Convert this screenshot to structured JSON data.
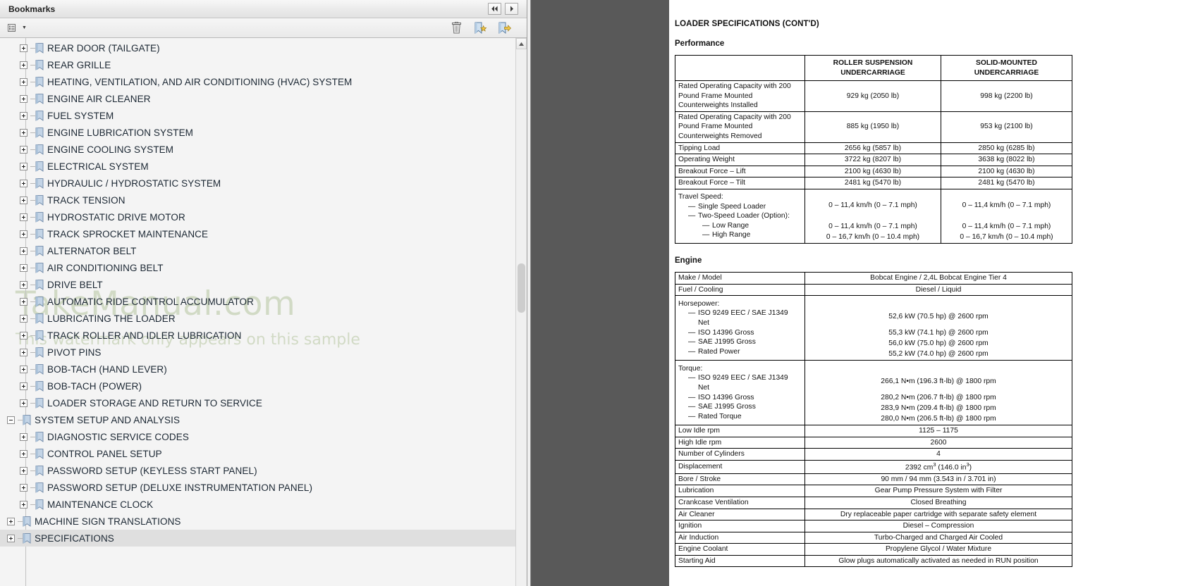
{
  "bookmarks_panel": {
    "title": "Bookmarks",
    "header_buttons": [
      {
        "name": "collapse-all",
        "glyph": "◀◀"
      },
      {
        "name": "expand",
        "glyph": "▶"
      }
    ],
    "toolbar": {
      "options_label": "Options",
      "delete_label": "Delete",
      "new_bookmark_label": "New Bookmark",
      "goto_bookmark_label": "Go To Bookmark"
    },
    "watermark_main": "TakeManual.com",
    "watermark_sub": "This watermark only appears on this sample",
    "items": [
      {
        "label": "REAR DOOR (TAILGATE)",
        "level": 1,
        "state": "plus"
      },
      {
        "label": "REAR GRILLE",
        "level": 1,
        "state": "plus"
      },
      {
        "label": "HEATING, VENTILATION, AND AIR CONDITIONING (HVAC) SYSTEM",
        "level": 1,
        "state": "plus"
      },
      {
        "label": "ENGINE AIR CLEANER",
        "level": 1,
        "state": "plus"
      },
      {
        "label": "FUEL SYSTEM",
        "level": 1,
        "state": "plus"
      },
      {
        "label": "ENGINE LUBRICATION SYSTEM",
        "level": 1,
        "state": "plus"
      },
      {
        "label": "ENGINE COOLING SYSTEM",
        "level": 1,
        "state": "plus"
      },
      {
        "label": "ELECTRICAL SYSTEM",
        "level": 1,
        "state": "plus"
      },
      {
        "label": "HYDRAULIC / HYDROSTATIC SYSTEM",
        "level": 1,
        "state": "plus"
      },
      {
        "label": "TRACK TENSION",
        "level": 1,
        "state": "plus"
      },
      {
        "label": "HYDROSTATIC DRIVE MOTOR",
        "level": 1,
        "state": "plus"
      },
      {
        "label": "TRACK SPROCKET MAINTENANCE",
        "level": 1,
        "state": "plus"
      },
      {
        "label": "ALTERNATOR BELT",
        "level": 1,
        "state": "plus"
      },
      {
        "label": "AIR CONDITIONING BELT",
        "level": 1,
        "state": "plus"
      },
      {
        "label": "DRIVE BELT",
        "level": 1,
        "state": "plus"
      },
      {
        "label": "AUTOMATIC RIDE CONTROL ACCUMULATOR",
        "level": 1,
        "state": "plus"
      },
      {
        "label": "LUBRICATING THE LOADER",
        "level": 1,
        "state": "plus"
      },
      {
        "label": "TRACK ROLLER AND IDLER LUBRICATION",
        "level": 1,
        "state": "plus"
      },
      {
        "label": "PIVOT PINS",
        "level": 1,
        "state": "plus"
      },
      {
        "label": "BOB-TACH (HAND LEVER)",
        "level": 1,
        "state": "plus"
      },
      {
        "label": "BOB-TACH (POWER)",
        "level": 1,
        "state": "plus"
      },
      {
        "label": "LOADER STORAGE AND RETURN TO SERVICE",
        "level": 1,
        "state": "plus"
      },
      {
        "label": "SYSTEM SETUP AND ANALYSIS",
        "level": 0,
        "state": "minus"
      },
      {
        "label": "DIAGNOSTIC SERVICE CODES",
        "level": 1,
        "state": "plus"
      },
      {
        "label": "CONTROL PANEL SETUP",
        "level": 1,
        "state": "plus"
      },
      {
        "label": "PASSWORD SETUP (KEYLESS START PANEL)",
        "level": 1,
        "state": "plus"
      },
      {
        "label": "PASSWORD SETUP (DELUXE INSTRUMENTATION PANEL)",
        "level": 1,
        "state": "plus"
      },
      {
        "label": "MAINTENANCE CLOCK",
        "level": 1,
        "state": "plus"
      },
      {
        "label": "MACHINE SIGN TRANSLATIONS",
        "level": 0,
        "state": "plus"
      },
      {
        "label": "SPECIFICATIONS",
        "level": 0,
        "state": "plus",
        "selected": true
      }
    ]
  },
  "document": {
    "title": "LOADER SPECIFICATIONS (CONT'D)",
    "performance": {
      "section_title": "Performance",
      "columns": [
        "",
        "ROLLER SUSPENSION UNDERCARRIAGE",
        "SOLID-MOUNTED UNDERCARRIAGE"
      ],
      "col1_header_lines": [
        "ROLLER SUSPENSION",
        "UNDERCARRIAGE"
      ],
      "col2_header_lines": [
        "SOLID-MOUNTED UNDERCARRIAGE"
      ],
      "rows": [
        {
          "label_lines": [
            "Rated Operating Capacity with 200",
            "Pound Frame Mounted",
            "Counterweights Installed"
          ],
          "roller": "929 kg (2050 lb)",
          "solid": "998 kg (2200 lb)"
        },
        {
          "label_lines": [
            "Rated Operating Capacity with 200",
            "Pound Frame Mounted",
            "Counterweights Removed"
          ],
          "roller": "885 kg (1950 lb)",
          "solid": "953 kg (2100 lb)"
        },
        {
          "label_lines": [
            "Tipping Load"
          ],
          "roller": "2656 kg (5857 lb)",
          "solid": "2850 kg (6285 lb)"
        },
        {
          "label_lines": [
            "Operating Weight"
          ],
          "roller": "3722 kg (8207 lb)",
          "solid": "3638 kg (8022 lb)"
        },
        {
          "label_lines": [
            "Breakout Force – Lift"
          ],
          "roller": "2100 kg (4630 lb)",
          "solid": "2100 kg (4630 lb)"
        },
        {
          "label_lines": [
            "Breakout Force – Tilt"
          ],
          "roller": "2481 kg (5470 lb)",
          "solid": "2481 kg (5470 lb)"
        }
      ],
      "travel_speed": {
        "header": "Travel Speed:",
        "entries": [
          {
            "label": "Single Speed Loader",
            "indent": 1,
            "roller": "0 – 11,4 km/h (0 – 7.1 mph)",
            "solid": "0 – 11,4 km/h (0 – 7.1 mph)"
          },
          {
            "label": "Two-Speed Loader (Option):",
            "indent": 1,
            "roller": "",
            "solid": ""
          },
          {
            "label": "Low Range",
            "indent": 2,
            "roller": "0 – 11,4 km/h (0 – 7.1 mph)",
            "solid": "0 – 11,4 km/h (0 – 7.1 mph)"
          },
          {
            "label": "High Range",
            "indent": 2,
            "roller": "0 – 16,7 km/h (0 – 10.4 mph)",
            "solid": "0 – 16,7 km/h (0 – 10.4 mph)"
          }
        ]
      }
    },
    "engine": {
      "section_title": "Engine",
      "rows": [
        {
          "label": "Make / Model",
          "value": "Bobcat Engine / 2,4L Bobcat Engine Tier 4"
        },
        {
          "label": "Fuel / Cooling",
          "value": "Diesel / Liquid"
        }
      ],
      "horsepower": {
        "header": "Horsepower:",
        "entries": [
          {
            "label_lines": [
              "ISO 9249 EEC / SAE J1349",
              "Net"
            ],
            "value": "52,6 kW (70.5 hp) @ 2600 rpm"
          },
          {
            "label_lines": [
              "ISO 14396 Gross"
            ],
            "value": "55,3 kW (74.1 hp) @ 2600 rpm"
          },
          {
            "label_lines": [
              "SAE J1995 Gross"
            ],
            "value": "56,0 kW (75.0 hp) @ 2600 rpm"
          },
          {
            "label_lines": [
              "Rated Power"
            ],
            "value": "55,2 kW (74.0 hp) @ 2600 rpm"
          }
        ]
      },
      "torque": {
        "header": "Torque:",
        "entries": [
          {
            "label_lines": [
              "ISO 9249 EEC / SAE J1349",
              "Net"
            ],
            "value": "266,1 N•m (196.3 ft-lb) @ 1800 rpm"
          },
          {
            "label_lines": [
              "ISO 14396 Gross"
            ],
            "value": "280,2 N•m (206.7 ft-lb) @ 1800 rpm"
          },
          {
            "label_lines": [
              "SAE J1995 Gross"
            ],
            "value": "283,9 N•m (209.4 ft-lb) @ 1800 rpm"
          },
          {
            "label_lines": [
              "Rated Torque"
            ],
            "value": "280,0 N•m (206.5 ft-lb) @ 1800 rpm"
          }
        ]
      },
      "rows_tail": [
        {
          "label": "Low Idle rpm",
          "value": "1125 – 1175"
        },
        {
          "label": "High Idle rpm",
          "value": "2600"
        },
        {
          "label": "Number of Cylinders",
          "value": "4"
        },
        {
          "label": "Displacement",
          "value": "2392 cm3 (146.0 in3)",
          "html_value": true
        },
        {
          "label": "Bore / Stroke",
          "value": "90 mm / 94 mm (3.543 in / 3.701 in)"
        },
        {
          "label": "Lubrication",
          "value": "Gear Pump Pressure System with Filter"
        },
        {
          "label": "Crankcase Ventilation",
          "value": "Closed Breathing"
        },
        {
          "label": "Air Cleaner",
          "value": "Dry replaceable paper cartridge with separate safety element"
        },
        {
          "label": "Ignition",
          "value": "Diesel – Compression"
        },
        {
          "label": "Air Induction",
          "value": "Turbo-Charged and Charged Air Cooled"
        },
        {
          "label": "Engine Coolant",
          "value": "Propylene Glycol / Water Mixture"
        },
        {
          "label": "Starting Aid",
          "value": "Glow plugs automatically activated as needed in RUN position"
        }
      ],
      "displacement_prefix": "2392 cm",
      "displacement_mid": " (146.0 in",
      "displacement_suffix": ")"
    }
  },
  "colors": {
    "panel_bg": "#f4f4f4",
    "gutter": "#595959",
    "selection": "#dfdfdf",
    "watermark": "#ccd6bd",
    "bookmark_icon": "#aebdd1"
  }
}
